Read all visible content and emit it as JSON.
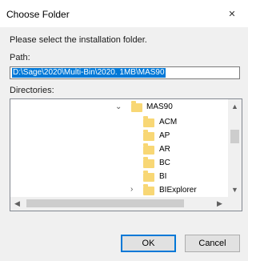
{
  "window": {
    "title": "Choose Folder",
    "close_glyph": "✕"
  },
  "prompt": "Please select the installation folder.",
  "path": {
    "label": "Path:",
    "value": "D:\\Sage\\2020\\Multi-Bin\\2020. 1MB\\MAS90"
  },
  "directories": {
    "label": "Directories:",
    "root": {
      "name": "MAS90",
      "expand_glyph": "⌄"
    },
    "items": [
      {
        "name": "ACM"
      },
      {
        "name": "AP"
      },
      {
        "name": "AR"
      },
      {
        "name": "BC"
      },
      {
        "name": "BI"
      },
      {
        "name": "BIExplorer",
        "expand_glyph": "›"
      }
    ],
    "icons": {
      "folder": "folder-icon",
      "scroll_up": "▲",
      "scroll_down": "▼",
      "scroll_left": "◀",
      "scroll_right": "▶"
    }
  },
  "buttons": {
    "ok": "OK",
    "cancel": "Cancel"
  },
  "colors": {
    "selection": "#0078d7",
    "folder": "#f8d775",
    "default_button_border": "#0078d7"
  }
}
